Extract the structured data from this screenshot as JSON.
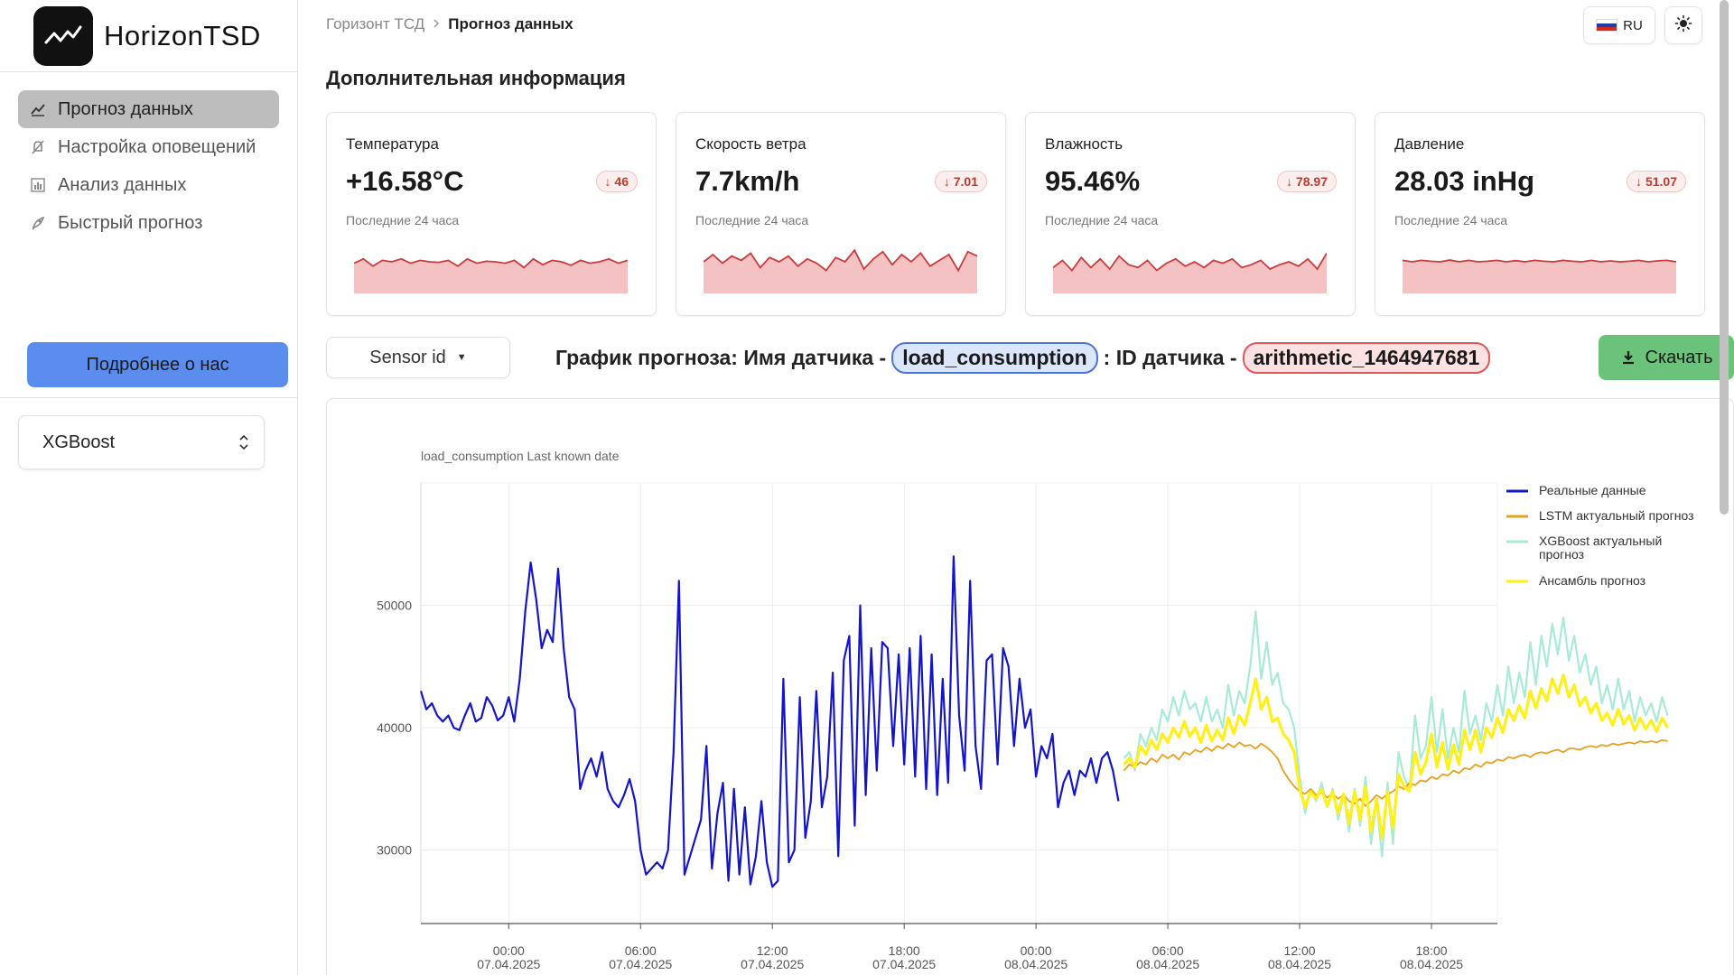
{
  "brand": {
    "name": "HorizonTSD"
  },
  "sidebar": {
    "items": [
      {
        "label": "Прогноз данных",
        "icon": "chart-line-icon",
        "active": true
      },
      {
        "label": "Настройка оповещений",
        "icon": "bell-off-icon",
        "active": false
      },
      {
        "label": "Анализ данных",
        "icon": "bar-chart-icon",
        "active": false
      },
      {
        "label": "Быстрый прогноз",
        "icon": "rocket-icon",
        "active": false
      }
    ],
    "about_button": "Подробнее о нас",
    "model_select": {
      "value": "XGBoost"
    }
  },
  "breadcrumb": {
    "root": "Горизонт ТСД",
    "current": "Прогноз данных"
  },
  "header": {
    "lang": "RU",
    "theme_icon": "sun-icon"
  },
  "section_title": "Дополнительная информация",
  "cards": [
    {
      "title": "Температура",
      "value": "+16.58°C",
      "badge": "↓ 46",
      "sub": "Последние 24 часа",
      "spark": [
        0.45,
        0.6,
        0.35,
        0.55,
        0.5,
        0.6,
        0.45,
        0.55,
        0.5,
        0.48,
        0.55,
        0.35,
        0.6,
        0.45,
        0.52,
        0.5,
        0.45,
        0.55,
        0.3,
        0.6,
        0.4,
        0.55,
        0.5,
        0.38,
        0.55,
        0.45,
        0.5,
        0.6,
        0.45,
        0.55
      ]
    },
    {
      "title": "Скорость ветра",
      "value": "7.7km/h",
      "badge": "↓ 7.01",
      "sub": "Последние 24 часа",
      "spark": [
        0.5,
        0.75,
        0.45,
        0.7,
        0.55,
        0.8,
        0.3,
        0.65,
        0.5,
        0.7,
        0.35,
        0.6,
        0.45,
        0.2,
        0.65,
        0.5,
        0.9,
        0.25,
        0.6,
        0.85,
        0.4,
        0.75,
        0.5,
        0.8,
        0.35,
        0.55,
        0.75,
        0.2,
        0.85,
        0.7
      ]
    },
    {
      "title": "Влажность",
      "value": "95.46%",
      "badge": "↓ 78.97",
      "sub": "Последние 24 часа",
      "spark": [
        0.3,
        0.55,
        0.2,
        0.65,
        0.3,
        0.6,
        0.25,
        0.7,
        0.4,
        0.3,
        0.55,
        0.2,
        0.45,
        0.6,
        0.35,
        0.5,
        0.3,
        0.55,
        0.45,
        0.6,
        0.3,
        0.4,
        0.55,
        0.25,
        0.4,
        0.5,
        0.35,
        0.6,
        0.25,
        0.8
      ]
    },
    {
      "title": "Давление",
      "value": "28.03 inHg",
      "badge": "↓ 51.07",
      "sub": "Последние 24 часа",
      "spark": [
        0.55,
        0.5,
        0.55,
        0.52,
        0.5,
        0.56,
        0.5,
        0.55,
        0.5,
        0.52,
        0.55,
        0.5,
        0.54,
        0.5,
        0.55,
        0.52,
        0.5,
        0.55,
        0.52,
        0.5,
        0.55,
        0.5,
        0.53,
        0.5,
        0.52,
        0.55,
        0.5,
        0.53,
        0.55,
        0.5
      ]
    }
  ],
  "toolbar": {
    "sensor_button": "Sensor id",
    "heading_prefix": "График прогноза: Имя датчика -",
    "sensor_name": "load_consumption",
    "heading_mid": ": ID датчика -",
    "sensor_id": "arithmetic_1464947681",
    "download": "Скачать"
  },
  "colors": {
    "real": "#1515c8",
    "lstm": "#e8a020",
    "xgboost": "#a8ead8",
    "ensemble": "#ffef1a",
    "spark_line": "#cc3b3b",
    "spark_fill": "#f4c2c2"
  },
  "chart_data": {
    "type": "line",
    "title": "load_consumption Last known date",
    "ylim": [
      24000,
      60000
    ],
    "y_ticks": [
      "30000",
      "40000",
      "50000"
    ],
    "x_ticks": [
      {
        "time": "00:00",
        "date": "07.04.2025"
      },
      {
        "time": "06:00",
        "date": "07.04.2025"
      },
      {
        "time": "12:00",
        "date": "07.04.2025"
      },
      {
        "time": "18:00",
        "date": "07.04.2025"
      },
      {
        "time": "00:00",
        "date": "08.04.2025"
      },
      {
        "time": "06:00",
        "date": "08.04.2025"
      },
      {
        "time": "12:00",
        "date": "08.04.2025"
      },
      {
        "time": "18:00",
        "date": "08.04.2025"
      }
    ],
    "x_start_hour": -4,
    "x_end_hour": 45,
    "series": [
      {
        "name": "Реальные данные",
        "start_hour": -4,
        "step_hours": 0.25,
        "values": [
          43000,
          41500,
          42000,
          41000,
          40500,
          41000,
          40000,
          39800,
          41000,
          42000,
          40500,
          40800,
          42500,
          41800,
          40600,
          41000,
          42500,
          40500,
          44000,
          49500,
          53500,
          50500,
          46500,
          48000,
          47000,
          53000,
          46500,
          42500,
          41500,
          35000,
          36500,
          37500,
          36000,
          38000,
          35000,
          34000,
          33500,
          34500,
          35800,
          34000,
          30000,
          28000,
          28500,
          29000,
          28500,
          30000,
          38000,
          52000,
          28000,
          29500,
          31000,
          32500,
          38500,
          28500,
          33000,
          35500,
          27500,
          35000,
          28000,
          33500,
          27200,
          29500,
          34000,
          29000,
          27000,
          27500,
          44000,
          29000,
          30000,
          42500,
          31000,
          34000,
          43000,
          33500,
          36000,
          44500,
          29500,
          45500,
          47500,
          32000,
          50000,
          34500,
          46500,
          36500,
          47000,
          46500,
          38500,
          46000,
          37000,
          46500,
          36000,
          47500,
          35000,
          46000,
          34500,
          44000,
          35500,
          54000,
          41000,
          36500,
          52000,
          38500,
          35000,
          45500,
          46000,
          37000,
          46500,
          45000,
          38500,
          44000,
          40000,
          41500,
          36000,
          38500,
          37500,
          39500,
          33500,
          35500,
          36500,
          34500,
          36500,
          36000,
          37500,
          35500,
          37500,
          38000,
          36500,
          34000
        ]
      },
      {
        "name": "LSTM актуальный прогноз",
        "start_hour": 28,
        "step_hours": 0.25,
        "values": [
          36500,
          37000,
          36800,
          37200,
          37000,
          37500,
          37200,
          37800,
          37500,
          37800,
          37400,
          38000,
          37800,
          38200,
          38000,
          38400,
          38100,
          38500,
          38300,
          38700,
          38400,
          38800,
          38500,
          38600,
          38300,
          38700,
          38400,
          38000,
          37500,
          36500,
          35800,
          35200,
          34800,
          34600,
          35000,
          34500,
          34700,
          34300,
          34600,
          34200,
          34500,
          34000,
          33800,
          34200,
          33600,
          34000,
          34500,
          34200,
          34600,
          34800,
          35200,
          35000,
          35500,
          35300,
          35700,
          35600,
          36000,
          35800,
          36200,
          36100,
          36500,
          36300,
          36700,
          36600,
          37000,
          36800,
          37200,
          37100,
          37400,
          37300,
          37600,
          37500,
          37700,
          37800,
          37600,
          37900,
          38000,
          37900,
          38100,
          38200,
          38000,
          38300,
          38300,
          38200,
          38400,
          38500,
          38400,
          38600,
          38500,
          38700,
          38600,
          38700,
          38800,
          38700,
          38900,
          38800,
          38900,
          38800,
          39000,
          38900
        ]
      },
      {
        "name": "XGBoost актуальный прогноз",
        "start_hour": 28,
        "step_hours": 0.25,
        "values": [
          37500,
          38000,
          36500,
          39500,
          38500,
          40000,
          39000,
          41500,
          40500,
          42500,
          41000,
          43000,
          41500,
          42000,
          40500,
          42500,
          40500,
          41500,
          40000,
          43500,
          41000,
          43000,
          42000,
          45000,
          49500,
          44000,
          47000,
          43500,
          44500,
          42000,
          41500,
          40000,
          36000,
          33000,
          35000,
          34000,
          35500,
          33500,
          35000,
          32500,
          34500,
          31500,
          35000,
          32000,
          36000,
          30500,
          34000,
          29500,
          35500,
          30500,
          38000,
          36000,
          35000,
          41000,
          37500,
          38500,
          42500,
          38000,
          41500,
          37500,
          40000,
          38000,
          43000,
          39500,
          41000,
          39000,
          42000,
          40500,
          43500,
          41000,
          45000,
          42000,
          44500,
          42500,
          47000,
          43500,
          47500,
          45000,
          48500,
          46000,
          49000,
          45500,
          47500,
          44500,
          46000,
          43500,
          45000,
          42000,
          43500,
          41500,
          44000,
          41500,
          43000,
          40500,
          42500,
          41000,
          42000,
          40500,
          42500,
          41000
        ]
      },
      {
        "name": "Ансамбль прогноз",
        "start_hour": 28,
        "step_hours": 0.25,
        "values": [
          37000,
          37500,
          36800,
          38500,
          37800,
          39000,
          38200,
          39500,
          38800,
          40000,
          39200,
          40500,
          39300,
          40000,
          38800,
          40200,
          38900,
          39800,
          39000,
          40800,
          39500,
          41000,
          40200,
          42000,
          44000,
          41500,
          42500,
          40500,
          40800,
          39500,
          39000,
          38000,
          35000,
          33500,
          34800,
          34200,
          35000,
          33600,
          34800,
          33000,
          34600,
          32200,
          34800,
          32500,
          35200,
          31500,
          34200,
          31000,
          34800,
          31800,
          36200,
          35200,
          34800,
          38000,
          36200,
          37200,
          39500,
          36800,
          38800,
          36600,
          38600,
          37000,
          39800,
          38200,
          39800,
          38000,
          40000,
          39200,
          40800,
          39600,
          41500,
          40600,
          41800,
          40800,
          43000,
          41600,
          43200,
          42200,
          44000,
          42800,
          44300,
          42500,
          43500,
          41800,
          42500,
          41200,
          42000,
          40600,
          41200,
          40200,
          41500,
          40300,
          41000,
          39800,
          40800,
          39900,
          40600,
          39700,
          40800,
          40000
        ]
      }
    ]
  }
}
